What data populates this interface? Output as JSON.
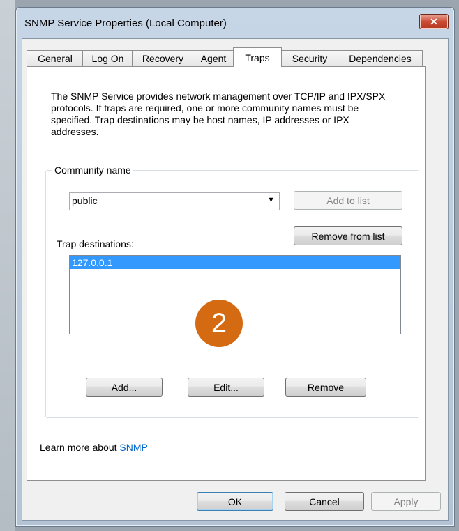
{
  "window": {
    "title": "SNMP Service Properties (Local Computer)",
    "close_glyph": "✕"
  },
  "tabs": [
    {
      "label": "General"
    },
    {
      "label": "Log On"
    },
    {
      "label": "Recovery"
    },
    {
      "label": "Agent"
    },
    {
      "label": "Traps"
    },
    {
      "label": "Security"
    },
    {
      "label": "Dependencies"
    }
  ],
  "active_tab": "Traps",
  "traps": {
    "description": "The SNMP Service provides network management over TCP/IP and IPX/SPX protocols. If traps are required, one or more community names must be specified. Trap destinations may be host names, IP addresses or IPX addresses.",
    "community_label": "Community name",
    "community_value": "public",
    "add_to_list": "Add to list",
    "remove_from_list": "Remove from list",
    "trap_destinations_label": "Trap destinations:",
    "destinations": [
      "127.0.0.1"
    ],
    "add": "Add...",
    "edit": "Edit...",
    "remove": "Remove",
    "learn_more_prefix": "Learn more about",
    "learn_more_link": "SNMP"
  },
  "footer": {
    "ok": "OK",
    "cancel": "Cancel",
    "apply": "Apply"
  },
  "step_marker": "2",
  "colors": {
    "marker": "#d46a12",
    "selection": "#3399ff",
    "link": "#0066cc",
    "close": "#cc4a33"
  }
}
